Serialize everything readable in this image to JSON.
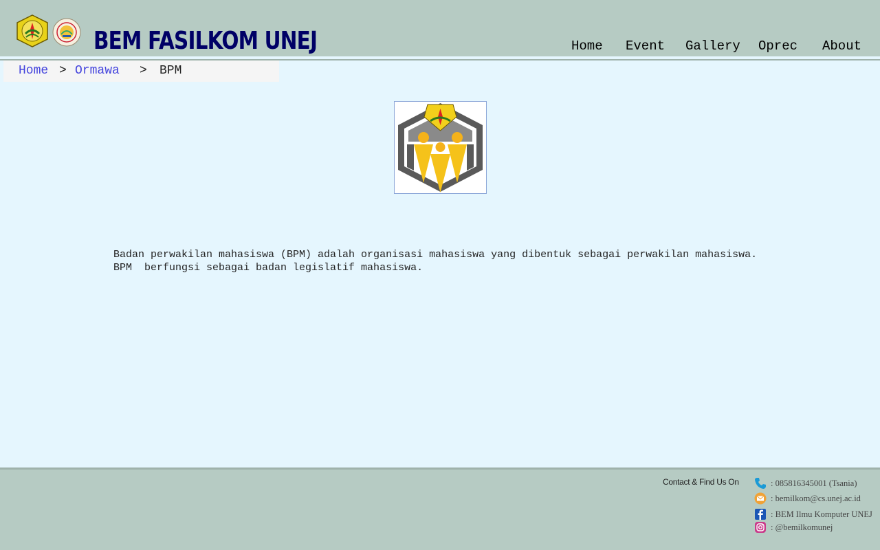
{
  "header": {
    "title": "BEM FASILKOM UNEJ",
    "nav": [
      {
        "label": "Home"
      },
      {
        "label": "Event"
      },
      {
        "label": "Gallery"
      },
      {
        "label": "Oprec"
      },
      {
        "label": "About"
      }
    ],
    "logos": [
      "university-seal-icon",
      "faculty-seal-icon"
    ]
  },
  "breadcrumb": {
    "items": [
      {
        "label": "Home",
        "link": true
      },
      {
        "label": "Ormawa",
        "link": true
      },
      {
        "label": "BPM",
        "link": false
      }
    ],
    "separator": ">"
  },
  "main": {
    "logo": "bpm-logo-icon",
    "description": [
      "Badan perwakilan mahasiswa (BPM) adalah organisasi mahasiswa yang dibentuk sebagai perwakilan mahasiswa.",
      "BPM  berfungsi sebagai badan legislatif mahasiswa."
    ]
  },
  "footer": {
    "contact_title": "Contact & Find Us On",
    "contacts": [
      {
        "icon": "phone-icon",
        "text": ": 085816345001 (Tsania)"
      },
      {
        "icon": "email-icon",
        "text": ": bemilkom@cs.unej.ac.id"
      },
      {
        "icon": "facebook-icon",
        "text": ": BEM Ilmu Komputer UNEJ"
      },
      {
        "icon": "instagram-icon",
        "text": ": @bemilkomunej"
      }
    ]
  },
  "colors": {
    "header_bg": "#b6cbc3",
    "page_bg": "#e5f6fe",
    "title": "#000066",
    "link": "#4444dd"
  }
}
